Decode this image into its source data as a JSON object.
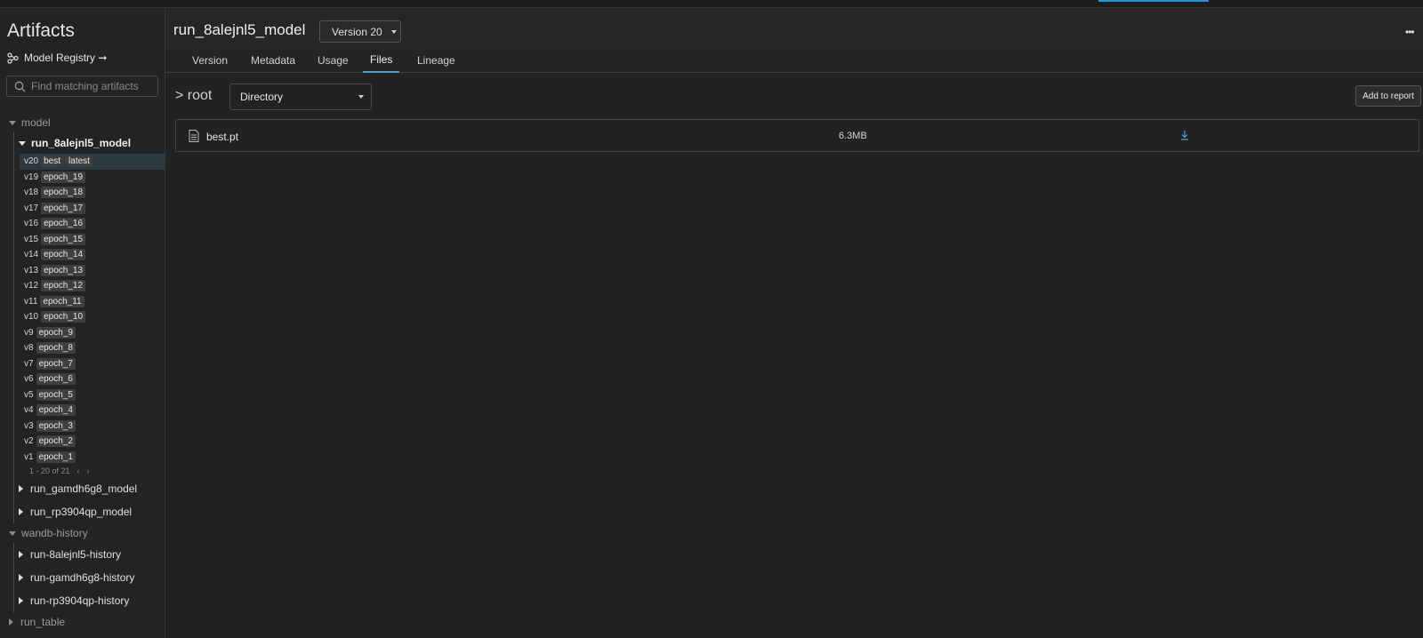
{
  "colors": {
    "accent": "#4aa0c8",
    "topbar_accent": "#1e9bd7"
  },
  "sidebar": {
    "title": "Artifacts",
    "registry_link": "Model Registry ➞",
    "search_placeholder": "Find matching artifacts",
    "groups": [
      {
        "name": "model",
        "expanded": true,
        "collections": [
          {
            "name": "run_8alejnl5_model",
            "expanded": true,
            "versions": [
              {
                "version": "v20",
                "tags": [
                  "best",
                  "latest"
                ],
                "selected": true
              },
              {
                "version": "v19",
                "tags": [
                  "epoch_19"
                ]
              },
              {
                "version": "v18",
                "tags": [
                  "epoch_18"
                ]
              },
              {
                "version": "v17",
                "tags": [
                  "epoch_17"
                ]
              },
              {
                "version": "v16",
                "tags": [
                  "epoch_16"
                ]
              },
              {
                "version": "v15",
                "tags": [
                  "epoch_15"
                ]
              },
              {
                "version": "v14",
                "tags": [
                  "epoch_14"
                ]
              },
              {
                "version": "v13",
                "tags": [
                  "epoch_13"
                ]
              },
              {
                "version": "v12",
                "tags": [
                  "epoch_12"
                ]
              },
              {
                "version": "v11",
                "tags": [
                  "epoch_11"
                ]
              },
              {
                "version": "v10",
                "tags": [
                  "epoch_10"
                ]
              },
              {
                "version": "v9",
                "tags": [
                  "epoch_9"
                ]
              },
              {
                "version": "v8",
                "tags": [
                  "epoch_8"
                ]
              },
              {
                "version": "v7",
                "tags": [
                  "epoch_7"
                ]
              },
              {
                "version": "v6",
                "tags": [
                  "epoch_6"
                ]
              },
              {
                "version": "v5",
                "tags": [
                  "epoch_5"
                ]
              },
              {
                "version": "v4",
                "tags": [
                  "epoch_4"
                ]
              },
              {
                "version": "v3",
                "tags": [
                  "epoch_3"
                ]
              },
              {
                "version": "v2",
                "tags": [
                  "epoch_2"
                ]
              },
              {
                "version": "v1",
                "tags": [
                  "epoch_1"
                ]
              }
            ],
            "pager": {
              "text": "1 - 20 of 21",
              "prev": "‹",
              "next": "›"
            }
          },
          {
            "name": "run_gamdh6g8_model",
            "expanded": false
          },
          {
            "name": "run_rp3904qp_model",
            "expanded": false
          }
        ]
      },
      {
        "name": "wandb-history",
        "expanded": true,
        "collections": [
          {
            "name": "run-8alejnl5-history",
            "expanded": false
          },
          {
            "name": "run-gamdh6g8-history",
            "expanded": false
          },
          {
            "name": "run-rp3904qp-history",
            "expanded": false
          }
        ]
      },
      {
        "name": "run_table",
        "expanded": false
      }
    ]
  },
  "header": {
    "title": "run_8alejnl5_model",
    "version_select": "Version 20",
    "more": "•••"
  },
  "tabs": [
    "Version",
    "Metadata",
    "Usage",
    "Files",
    "Lineage"
  ],
  "active_tab": "Files",
  "files": {
    "breadcrumb": "> root",
    "view_select": "Directory",
    "add_to_report": "Add to report",
    "rows": [
      {
        "name": "best.pt",
        "size": "6.3MB"
      }
    ]
  }
}
